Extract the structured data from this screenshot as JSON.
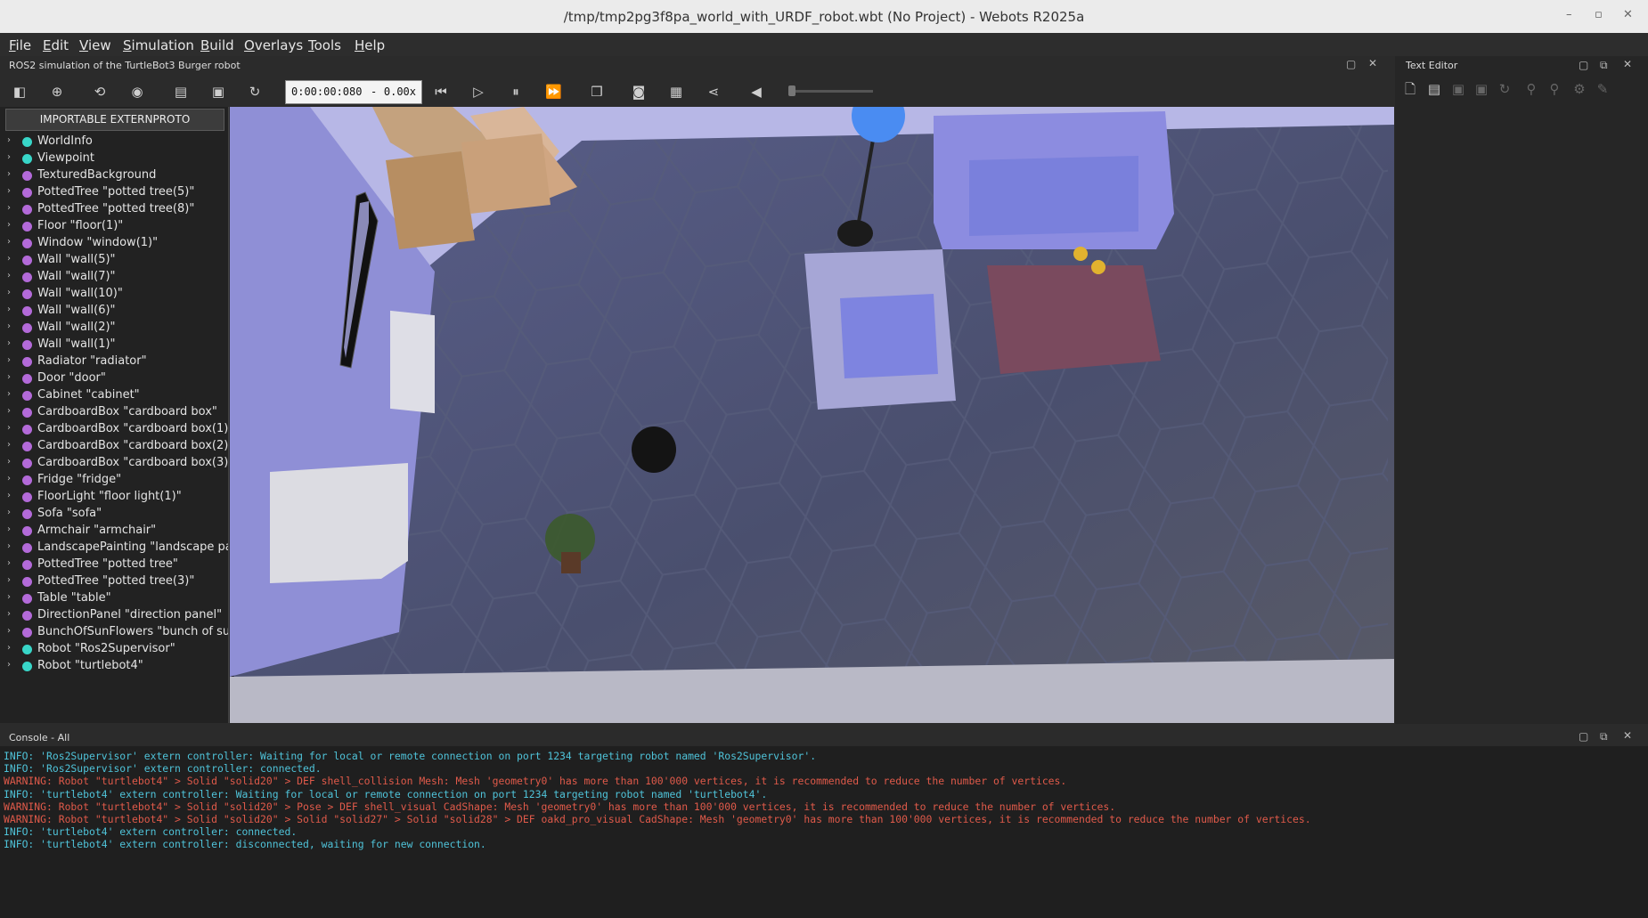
{
  "window": {
    "title": "/tmp/tmp2pg3f8pa_world_with_URDF_robot.wbt (No Project) - Webots R2025a"
  },
  "menu": [
    {
      "label": "File",
      "u": "F",
      "rest": "ile"
    },
    {
      "label": "Edit",
      "u": "E",
      "rest": "dit"
    },
    {
      "label": "View",
      "u": "V",
      "rest": "iew"
    },
    {
      "label": "Simulation",
      "u": "S",
      "rest": "imulation"
    },
    {
      "label": "Build",
      "u": "B",
      "rest": "uild"
    },
    {
      "label": "Overlays",
      "u": "O",
      "rest": "verlays"
    },
    {
      "label": "Tools",
      "u": "T",
      "rest": "ools"
    },
    {
      "label": "Help",
      "u": "H",
      "rest": "elp"
    }
  ],
  "world_info": {
    "subtitle": "ROS2 simulation of the TurtleBot3 Burger robot"
  },
  "toolbar": {
    "time": "0:00:00:080",
    "separator": "-",
    "speed": "0.00x",
    "volume_level": 0
  },
  "scene_tree": {
    "extern_button": "IMPORTABLE EXTERNPROTO",
    "nodes": [
      {
        "label": "WorldInfo",
        "color": "#38d6c8"
      },
      {
        "label": "Viewpoint",
        "color": "#38d6c8"
      },
      {
        "label": "TexturedBackground",
        "color": "#b36ad9"
      },
      {
        "label": "PottedTree \"potted tree(5)\"",
        "color": "#b36ad9"
      },
      {
        "label": "PottedTree \"potted tree(8)\"",
        "color": "#b36ad9"
      },
      {
        "label": "Floor \"floor(1)\"",
        "color": "#b36ad9"
      },
      {
        "label": "Window \"window(1)\"",
        "color": "#b36ad9"
      },
      {
        "label": "Wall \"wall(5)\"",
        "color": "#b36ad9"
      },
      {
        "label": "Wall \"wall(7)\"",
        "color": "#b36ad9"
      },
      {
        "label": "Wall \"wall(10)\"",
        "color": "#b36ad9"
      },
      {
        "label": "Wall \"wall(6)\"",
        "color": "#b36ad9"
      },
      {
        "label": "Wall \"wall(2)\"",
        "color": "#b36ad9"
      },
      {
        "label": "Wall \"wall(1)\"",
        "color": "#b36ad9"
      },
      {
        "label": "Radiator \"radiator\"",
        "color": "#b36ad9"
      },
      {
        "label": "Door \"door\"",
        "color": "#b36ad9"
      },
      {
        "label": "Cabinet \"cabinet\"",
        "color": "#b36ad9"
      },
      {
        "label": "CardboardBox \"cardboard box\"",
        "color": "#b36ad9"
      },
      {
        "label": "CardboardBox \"cardboard box(1)\"",
        "color": "#b36ad9"
      },
      {
        "label": "CardboardBox \"cardboard box(2)\"",
        "color": "#b36ad9"
      },
      {
        "label": "CardboardBox \"cardboard box(3)\"",
        "color": "#b36ad9"
      },
      {
        "label": "Fridge \"fridge\"",
        "color": "#b36ad9"
      },
      {
        "label": "FloorLight \"floor light(1)\"",
        "color": "#b36ad9"
      },
      {
        "label": "Sofa \"sofa\"",
        "color": "#b36ad9"
      },
      {
        "label": "Armchair \"armchair\"",
        "color": "#b36ad9"
      },
      {
        "label": "LandscapePainting \"landscape painting\"",
        "color": "#b36ad9"
      },
      {
        "label": "PottedTree \"potted tree\"",
        "color": "#b36ad9"
      },
      {
        "label": "PottedTree \"potted tree(3)\"",
        "color": "#b36ad9"
      },
      {
        "label": "Table \"table\"",
        "color": "#b36ad9"
      },
      {
        "label": "DirectionPanel \"direction panel\"",
        "color": "#b36ad9"
      },
      {
        "label": "BunchOfSunFlowers \"bunch of sunflowers\"",
        "color": "#b36ad9"
      },
      {
        "label": "Robot \"Ros2Supervisor\"",
        "color": "#38d6c8"
      },
      {
        "label": "Robot \"turtlebot4\"",
        "color": "#38d6c8"
      }
    ]
  },
  "text_editor": {
    "title": "Text Editor"
  },
  "console": {
    "title": "Console - All",
    "lines": [
      {
        "level": "info",
        "text": "INFO: 'Ros2Supervisor' extern controller: Waiting for local or remote connection on port 1234 targeting robot named 'Ros2Supervisor'."
      },
      {
        "level": "info",
        "text": "INFO: 'Ros2Supervisor' extern controller: connected."
      },
      {
        "level": "warn",
        "text": "WARNING: Robot \"turtlebot4\" > Solid \"solid20\" > DEF shell_collision Mesh: Mesh 'geometry0' has more than 100'000 vertices, it is recommended to reduce the number of vertices."
      },
      {
        "level": "info",
        "text": "INFO: 'turtlebot4' extern controller: Waiting for local or remote connection on port 1234 targeting robot named 'turtlebot4'."
      },
      {
        "level": "warn",
        "text": "WARNING: Robot \"turtlebot4\" > Solid \"solid20\" > Pose  > DEF shell_visual CadShape: Mesh 'geometry0' has more than 100'000 vertices, it is recommended to reduce the number of vertices."
      },
      {
        "level": "warn",
        "text": "WARNING: Robot \"turtlebot4\" > Solid \"solid20\" > Solid \"solid27\" > Solid \"solid28\" > DEF oakd_pro_visual CadShape: Mesh 'geometry0' has more than 100'000 vertices, it is recommended to reduce the number of vertices."
      },
      {
        "level": "info",
        "text": "INFO: 'turtlebot4' extern controller: connected."
      },
      {
        "level": "info",
        "text": "INFO: 'turtlebot4' extern controller: disconnected, waiting for new connection."
      }
    ]
  }
}
